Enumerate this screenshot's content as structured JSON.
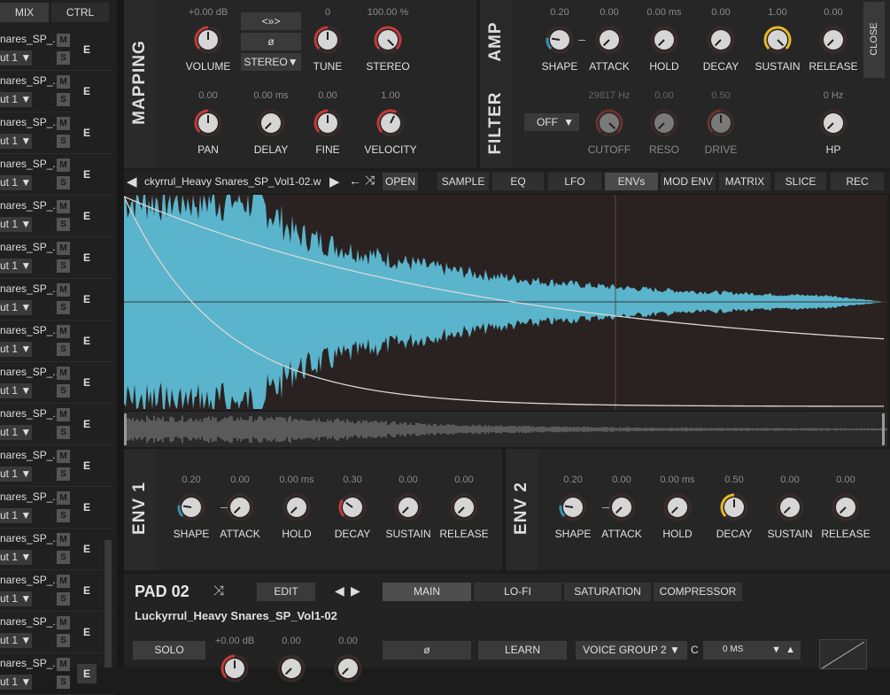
{
  "mixer": {
    "tabs": [
      "MIX",
      "CTRL"
    ],
    "channels": [
      {
        "name": "nares_SP_...",
        "out": "ut 1 ▼",
        "m": "M",
        "s": "S",
        "e": "E"
      },
      {
        "name": "nares_SP_...",
        "out": "ut 1 ▼",
        "m": "M",
        "s": "S",
        "e": "E"
      },
      {
        "name": "nares_SP_...",
        "out": "ut 1 ▼",
        "m": "M",
        "s": "S",
        "e": "E"
      },
      {
        "name": "nares_SP_...",
        "out": "ut 1 ▼",
        "m": "M",
        "s": "S",
        "e": "E"
      },
      {
        "name": "nares_SP_...",
        "out": "ut 1 ▼",
        "m": "M",
        "s": "S",
        "e": "E"
      },
      {
        "name": "nares_SP_...",
        "out": "ut 1 ▼",
        "m": "M",
        "s": "S",
        "e": "E"
      },
      {
        "name": "nares_SP_...",
        "out": "ut 1 ▼",
        "m": "M",
        "s": "S",
        "e": "E"
      },
      {
        "name": "nares_SP_...",
        "out": "ut 1 ▼",
        "m": "M",
        "s": "S",
        "e": "E"
      },
      {
        "name": "nares_SP_...",
        "out": "ut 1 ▼",
        "m": "M",
        "s": "S",
        "e": "E"
      },
      {
        "name": "nares_SP_...",
        "out": "ut 1 ▼",
        "m": "M",
        "s": "S",
        "e": "E"
      },
      {
        "name": "nares_SP_...",
        "out": "ut 1 ▼",
        "m": "M",
        "s": "S",
        "e": "E"
      },
      {
        "name": "nares_SP_...",
        "out": "ut 1 ▼",
        "m": "M",
        "s": "S",
        "e": "E"
      },
      {
        "name": "nares_SP_...",
        "out": "ut 1 ▼",
        "m": "M",
        "s": "S",
        "e": "E"
      },
      {
        "name": "nares_SP_...",
        "out": "ut 1 ▼",
        "m": "M",
        "s": "S",
        "e": "E"
      },
      {
        "name": "nares_SP_...",
        "out": "ut 1 ▼",
        "m": "M",
        "s": "S",
        "e": "E"
      },
      {
        "name": "nares_SP_...",
        "out": "ut 1 ▼",
        "m": "M",
        "s": "S",
        "e": "E"
      }
    ]
  },
  "mapping": {
    "label": "MAPPING",
    "knobs_row1": [
      {
        "name": "VOLUME",
        "value": "+0.00 dB"
      },
      {
        "name": "TUNE",
        "value": "0"
      },
      {
        "name": "STEREO",
        "value": "100.00 %"
      }
    ],
    "knobs_row2": [
      {
        "name": "PAN",
        "value": "0.00"
      },
      {
        "name": "DELAY",
        "value": "0.00 ms"
      },
      {
        "name": "FINE",
        "value": "0.00"
      },
      {
        "name": "VELOCITY",
        "value": "1.00"
      }
    ],
    "btn_swap": "<»>",
    "btn_phase": "ø",
    "stereo_mode": "STEREO▼"
  },
  "amp": {
    "label": "AMP",
    "knobs": [
      {
        "name": "SHAPE",
        "value": "0.20"
      },
      {
        "name": "ATTACK",
        "value": "0.00"
      },
      {
        "name": "HOLD",
        "value": "0.00 ms"
      },
      {
        "name": "DECAY",
        "value": "0.00"
      },
      {
        "name": "SUSTAIN",
        "value": "1.00"
      },
      {
        "name": "RELEASE",
        "value": "0.00"
      }
    ],
    "close": "CLOSE"
  },
  "filter": {
    "label": "FILTER",
    "mode": "OFF",
    "knobs": [
      {
        "name": "CUTOFF",
        "value": "29817 Hz"
      },
      {
        "name": "RESO",
        "value": "0.00"
      },
      {
        "name": "DRIVE",
        "value": "0.50"
      },
      {
        "name": "HP",
        "value": "0 Hz"
      }
    ]
  },
  "sampler": {
    "filename": "ckyrrul_Heavy Snares_SP_Vol1-02.w",
    "open": "OPEN",
    "tabs": [
      "SAMPLE",
      "EQ",
      "LFO",
      "ENVs",
      "MOD ENV",
      "MATRIX",
      "SLICE",
      "REC"
    ],
    "active_tab": "ENVs"
  },
  "env1": {
    "label": "ENV 1",
    "knobs": [
      {
        "name": "SHAPE",
        "value": "0.20"
      },
      {
        "name": "ATTACK",
        "value": "0.00"
      },
      {
        "name": "HOLD",
        "value": "0.00 ms"
      },
      {
        "name": "DECAY",
        "value": "0.30"
      },
      {
        "name": "SUSTAIN",
        "value": "0.00"
      },
      {
        "name": "RELEASE",
        "value": "0.00"
      }
    ]
  },
  "env2": {
    "label": "ENV 2",
    "knobs": [
      {
        "name": "SHAPE",
        "value": "0.20"
      },
      {
        "name": "ATTACK",
        "value": "0.00"
      },
      {
        "name": "HOLD",
        "value": "0.00 ms"
      },
      {
        "name": "DECAY",
        "value": "0.50"
      },
      {
        "name": "SUSTAIN",
        "value": "0.00"
      },
      {
        "name": "RELEASE",
        "value": "0.00"
      }
    ]
  },
  "pad": {
    "title": "PAD 02",
    "edit": "EDIT",
    "tabs": [
      "MAIN",
      "LO-FI",
      "SATURATION",
      "COMPRESSOR"
    ],
    "active_tab": "MAIN",
    "sample_name": "Luckyrrul_Heavy Snares_SP_Vol1-02",
    "solo": "SOLO",
    "bottom_values": [
      "+0.00 dB",
      "0.00",
      "0.00"
    ],
    "phase": "ø",
    "learn": "LEARN",
    "voice_group": "VOICE GROUP 2 ▼",
    "c_label": "C",
    "ms": "0 MS"
  }
}
